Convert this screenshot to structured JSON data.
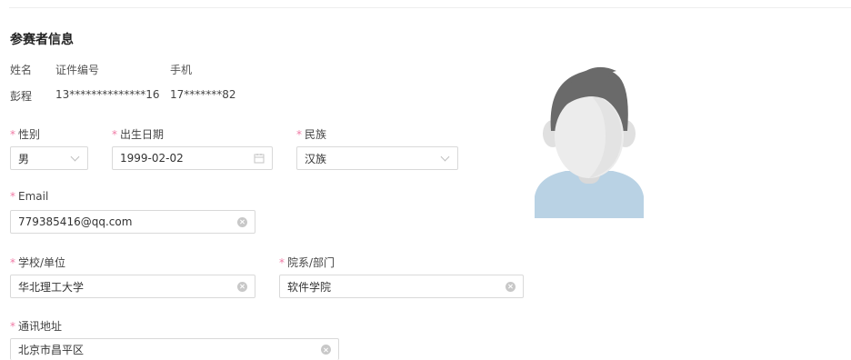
{
  "section": {
    "title": "参赛者信息"
  },
  "info": {
    "headers": {
      "name": "姓名",
      "id": "证件编号",
      "phone": "手机"
    },
    "values": {
      "name": "彭程",
      "id": "13**************16",
      "phone": "17*******82"
    }
  },
  "fields": {
    "gender": {
      "label": "性别",
      "value": "男",
      "icon": "chevron-down-icon"
    },
    "birthdate": {
      "label": "出生日期",
      "value": "1999-02-02",
      "icon": "calendar-icon"
    },
    "ethnicity": {
      "label": "民族",
      "value": "汉族",
      "icon": "chevron-down-icon"
    },
    "email": {
      "label": "Email",
      "value": "779385416@qq.com",
      "icon": "clear-icon"
    },
    "school": {
      "label": "学校/单位",
      "value": "华北理工大学",
      "icon": "clear-icon"
    },
    "department": {
      "label": "院系/部门",
      "value": "软件学院",
      "icon": "clear-icon"
    },
    "address": {
      "label": "通讯地址",
      "value": "北京市昌平区",
      "icon": "clear-icon"
    }
  },
  "required_marker": "*",
  "colors": {
    "required": "#f07ca6",
    "border": "#d9d9d9",
    "avatar_hair": "#6a6a6a",
    "avatar_skin": "#ececec",
    "avatar_shirt": "#b9d2e4"
  },
  "avatar": {
    "icon": "default-avatar-icon"
  }
}
